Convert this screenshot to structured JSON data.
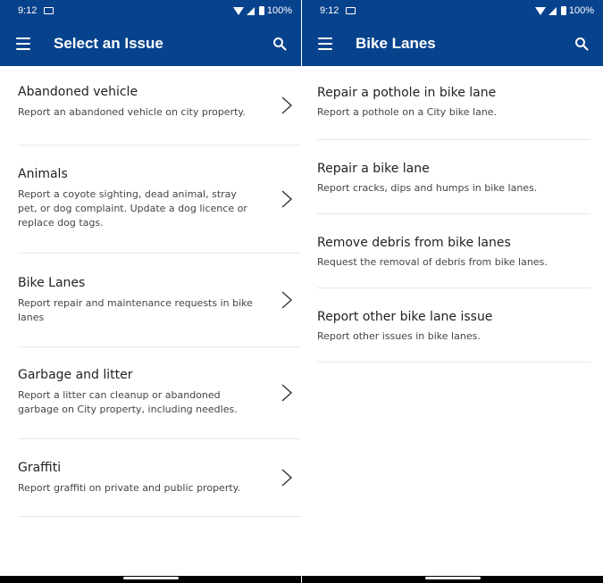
{
  "status_bar": {
    "time": "9:12",
    "battery": "100%"
  },
  "left_screen": {
    "title": "Select an Issue",
    "items": [
      {
        "title": "Abandoned vehicle",
        "description": "Report an abandoned vehicle on city property."
      },
      {
        "title": "Animals",
        "description": "Report a coyote sighting, dead animal, stray pet, or dog complaint.  Update a dog licence or replace dog tags."
      },
      {
        "title": "Bike Lanes",
        "description": "Report repair and maintenance requests in bike lanes"
      },
      {
        "title": "Garbage and litter",
        "description": "Report a litter can cleanup or abandoned garbage on City property, including needles."
      },
      {
        "title": "Graffiti",
        "description": "Report graffiti on private and public property."
      }
    ]
  },
  "right_screen": {
    "title": "Bike Lanes",
    "items": [
      {
        "title": "Repair a pothole in bike lane",
        "description": "Report a pothole on a City bike lane."
      },
      {
        "title": "Repair a bike lane",
        "description": "Report cracks, dips and humps in bike lanes."
      },
      {
        "title": "Remove debris from bike lanes",
        "description": "Request the removal of debris from bike lanes."
      },
      {
        "title": "Report other bike lane issue",
        "description": "Report other issues in bike lanes."
      }
    ]
  },
  "colors": {
    "app_bar": "#07428c",
    "text": "#222222",
    "divider": "#e7e7e7"
  },
  "icons": {
    "menu": "menu-icon",
    "search": "search-icon",
    "chevron": "chevron-right-icon"
  }
}
